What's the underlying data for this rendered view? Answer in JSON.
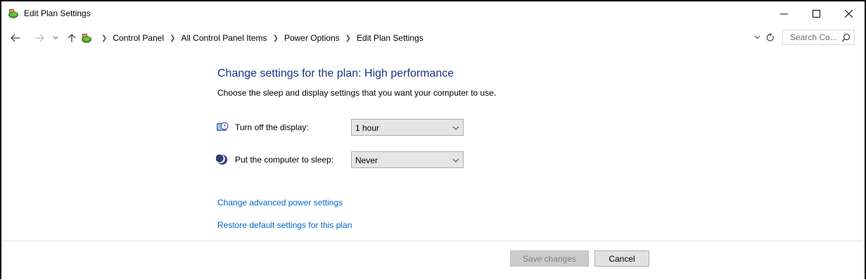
{
  "window": {
    "title": "Edit Plan Settings",
    "controls": {
      "minimize": "minimize",
      "maximize": "maximize",
      "close": "close"
    }
  },
  "addressbar": {
    "crumbs": [
      "Control Panel",
      "All Control Panel Items",
      "Power Options",
      "Edit Plan Settings"
    ],
    "search_placeholder": "Search Co..."
  },
  "main": {
    "heading": "Change settings for the plan: High performance",
    "subtext": "Choose the sleep and display settings that you want your computer to use.",
    "settings": [
      {
        "label": "Turn off the display:",
        "value": "1 hour",
        "icon": "display-timer-icon"
      },
      {
        "label": "Put the computer to sleep:",
        "value": "Never",
        "icon": "sleep-moon-icon"
      }
    ],
    "links": {
      "advanced": "Change advanced power settings",
      "restore": "Restore default settings for this plan"
    }
  },
  "footer": {
    "save_label": "Save changes",
    "cancel_label": "Cancel"
  },
  "colors": {
    "heading": "#1e3287",
    "link": "#0066cc",
    "disabled_text": "#838383"
  }
}
